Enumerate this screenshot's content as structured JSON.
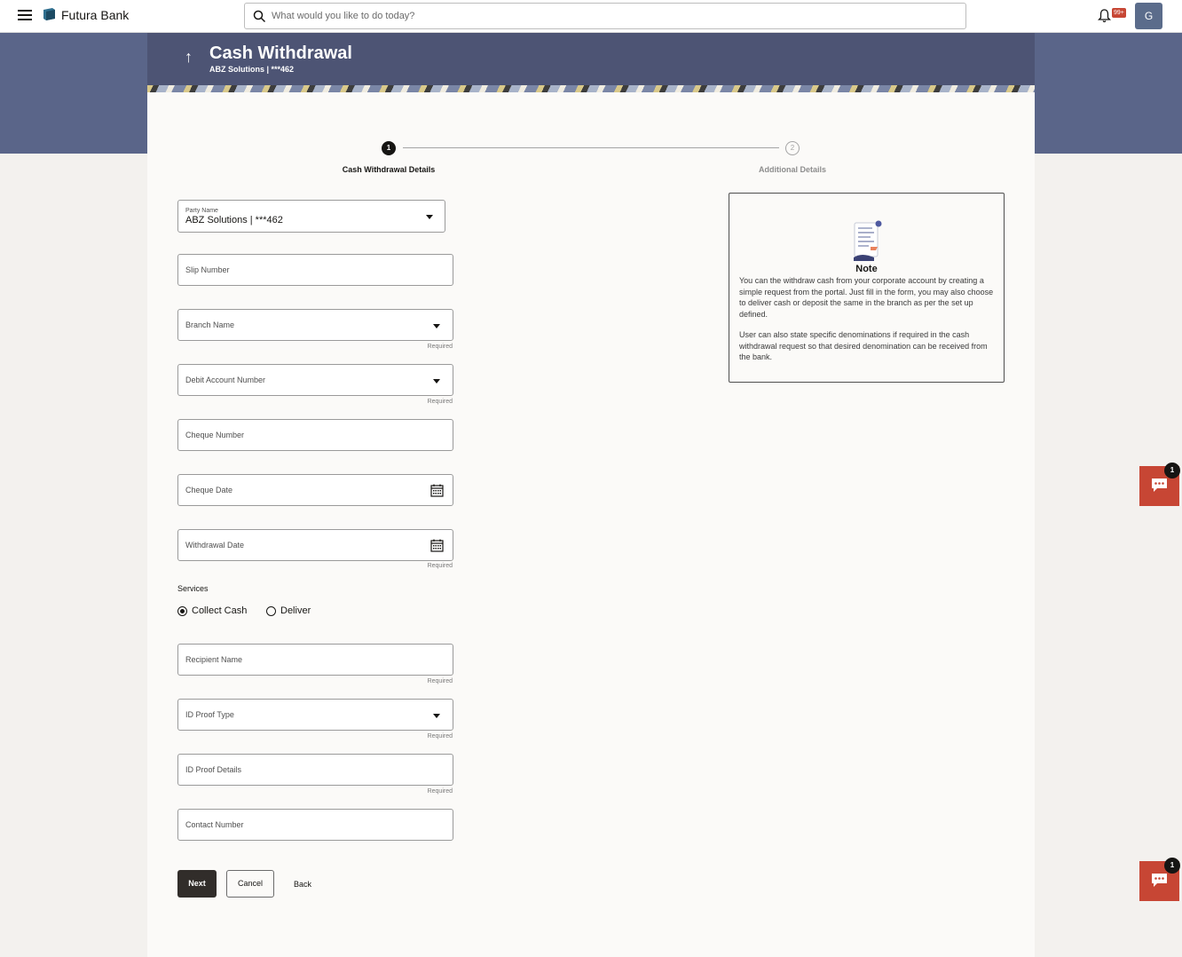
{
  "app": {
    "brand": "Futura Bank",
    "search_placeholder": "What would you like to do today?",
    "notification_count": "99+",
    "avatar_initial": "G"
  },
  "header": {
    "title": "Cash Withdrawal",
    "subtitle": "ABZ Solutions | ***462"
  },
  "stepper": {
    "steps": [
      {
        "number": "1",
        "label": "Cash Withdrawal Details",
        "active": true
      },
      {
        "number": "2",
        "label": "Additional Details",
        "active": false
      }
    ]
  },
  "form": {
    "party": {
      "label": "Party Name",
      "value": "ABZ Solutions | ***462"
    },
    "slip_number": "Slip Number",
    "branch_name": "Branch Name",
    "debit_account": "Debit Account Number",
    "cheque_number": "Cheque Number",
    "cheque_date": "Cheque Date",
    "withdrawal_date": "Withdrawal Date",
    "required": "Required",
    "services": {
      "label": "Services",
      "options": [
        "Collect Cash",
        "Deliver"
      ],
      "selected": "Collect Cash"
    },
    "recipient_name": "Recipient Name",
    "id_proof_type": "ID Proof Type",
    "id_proof_details": "ID Proof Details",
    "contact_number": "Contact Number"
  },
  "actions": {
    "next": "Next",
    "cancel": "Cancel",
    "back": "Back"
  },
  "note": {
    "title": "Note",
    "paragraph1": "You can the withdraw cash from your corporate account by creating a simple request from the portal. Just fill in the form, you may also choose to deliver cash or deposit the same in the branch as per the set up defined.",
    "paragraph2": "User can also state specific denominations if required in the cash withdrawal request so that desired denomination can be received from the bank."
  },
  "chat": {
    "badge1": "1",
    "badge2": "1"
  },
  "colors": {
    "accent": "#c74634",
    "header_band": "#5a6589",
    "primary_button": "#312d2a"
  }
}
